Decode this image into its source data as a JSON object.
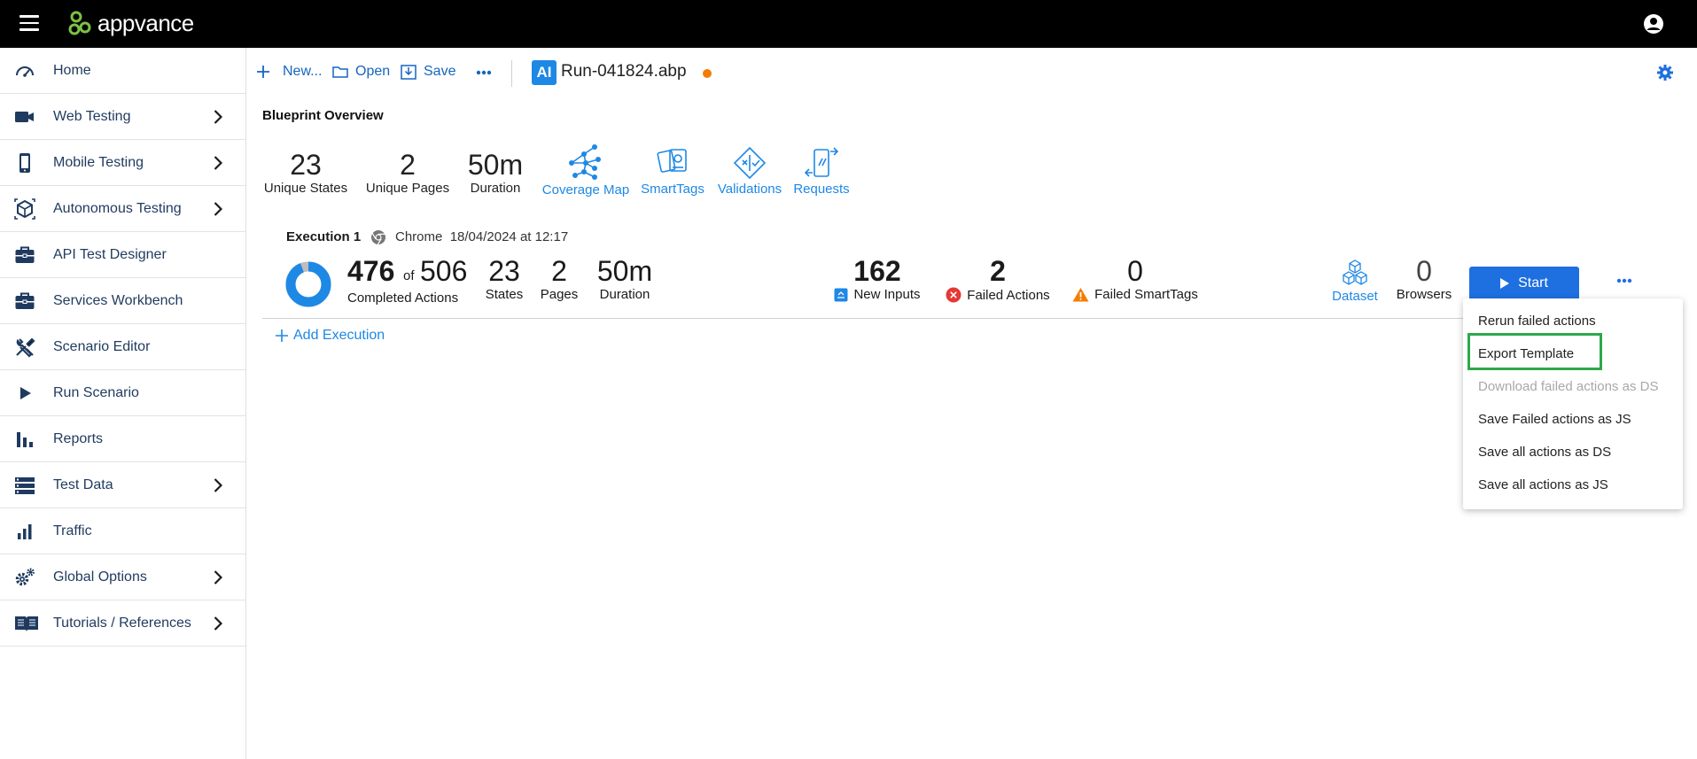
{
  "topbar": {
    "brand": "appvance"
  },
  "sidebar": {
    "items": [
      {
        "label": "Home",
        "icon": "speedometer-icon",
        "has_arrow": false
      },
      {
        "label": "Web Testing",
        "icon": "video-camera-icon",
        "has_arrow": true
      },
      {
        "label": "Mobile Testing",
        "icon": "mobile-phone-icon",
        "has_arrow": true
      },
      {
        "label": "Autonomous Testing",
        "icon": "ai-cube-icon",
        "has_arrow": true
      },
      {
        "label": "API Test Designer",
        "icon": "briefcase-icon",
        "has_arrow": false
      },
      {
        "label": "Services Workbench",
        "icon": "briefcase-icon",
        "has_arrow": false
      },
      {
        "label": "Scenario Editor",
        "icon": "tools-icon",
        "has_arrow": false
      },
      {
        "label": "Run Scenario",
        "icon": "play-icon",
        "has_arrow": false
      },
      {
        "label": "Reports",
        "icon": "bar-chart-icon",
        "has_arrow": false
      },
      {
        "label": "Test Data",
        "icon": "table-rows-icon",
        "has_arrow": true
      },
      {
        "label": "Traffic",
        "icon": "signal-bars-icon",
        "has_arrow": false
      },
      {
        "label": "Global Options",
        "icon": "gears-icon",
        "has_arrow": true
      },
      {
        "label": "Tutorials / References",
        "icon": "book-icon",
        "has_arrow": true
      }
    ]
  },
  "toolbar": {
    "new_label": "New...",
    "open_label": "Open",
    "save_label": "Save",
    "ai_badge": "AI",
    "file_name": "Run-041824.abp"
  },
  "blueprint": {
    "title": "Blueprint Overview",
    "unique_states": {
      "value": "23",
      "label": "Unique States"
    },
    "unique_pages": {
      "value": "2",
      "label": "Unique Pages"
    },
    "duration": {
      "value": "50m",
      "label": "Duration"
    },
    "links": [
      "Coverage Map",
      "SmartTags",
      "Validations",
      "Requests"
    ]
  },
  "execution": {
    "title": "Execution 1",
    "browser": "Chrome",
    "datetime": "18/04/2024 at 12:17",
    "completed": "476",
    "of": "of",
    "total": "506",
    "completed_fraction": 0.9407,
    "completed_label": "Completed Actions",
    "states": {
      "value": "23",
      "label": "States"
    },
    "pages": {
      "value": "2",
      "label": "Pages"
    },
    "duration": {
      "value": "50m",
      "label": "Duration"
    },
    "new_inputs": {
      "value": "162",
      "label": "New Inputs"
    },
    "failed_actions": {
      "value": "2",
      "label": "Failed Actions"
    },
    "failed_smarttags": {
      "value": "0",
      "label": "Failed SmartTags"
    },
    "dataset_label": "Dataset",
    "browsers": {
      "value": "0",
      "label": "Browsers"
    },
    "start_label": "Start",
    "add_execution_label": "Add Execution"
  },
  "menu": {
    "items": [
      {
        "label": "Rerun failed actions",
        "disabled": false
      },
      {
        "label": "Export Template",
        "disabled": false
      },
      {
        "label": "Download failed actions as DS",
        "disabled": true
      },
      {
        "label": "Save Failed actions as JS",
        "disabled": false
      },
      {
        "label": "Save all actions as DS",
        "disabled": false
      },
      {
        "label": "Save all actions as JS",
        "disabled": false
      }
    ]
  },
  "colors": {
    "accent": "#1e88e5",
    "start_button": "#1e6fe0",
    "highlight": "#2ea84c",
    "unsaved_dot": "#f57c00",
    "error": "#e53935",
    "warning": "#f57c00"
  }
}
